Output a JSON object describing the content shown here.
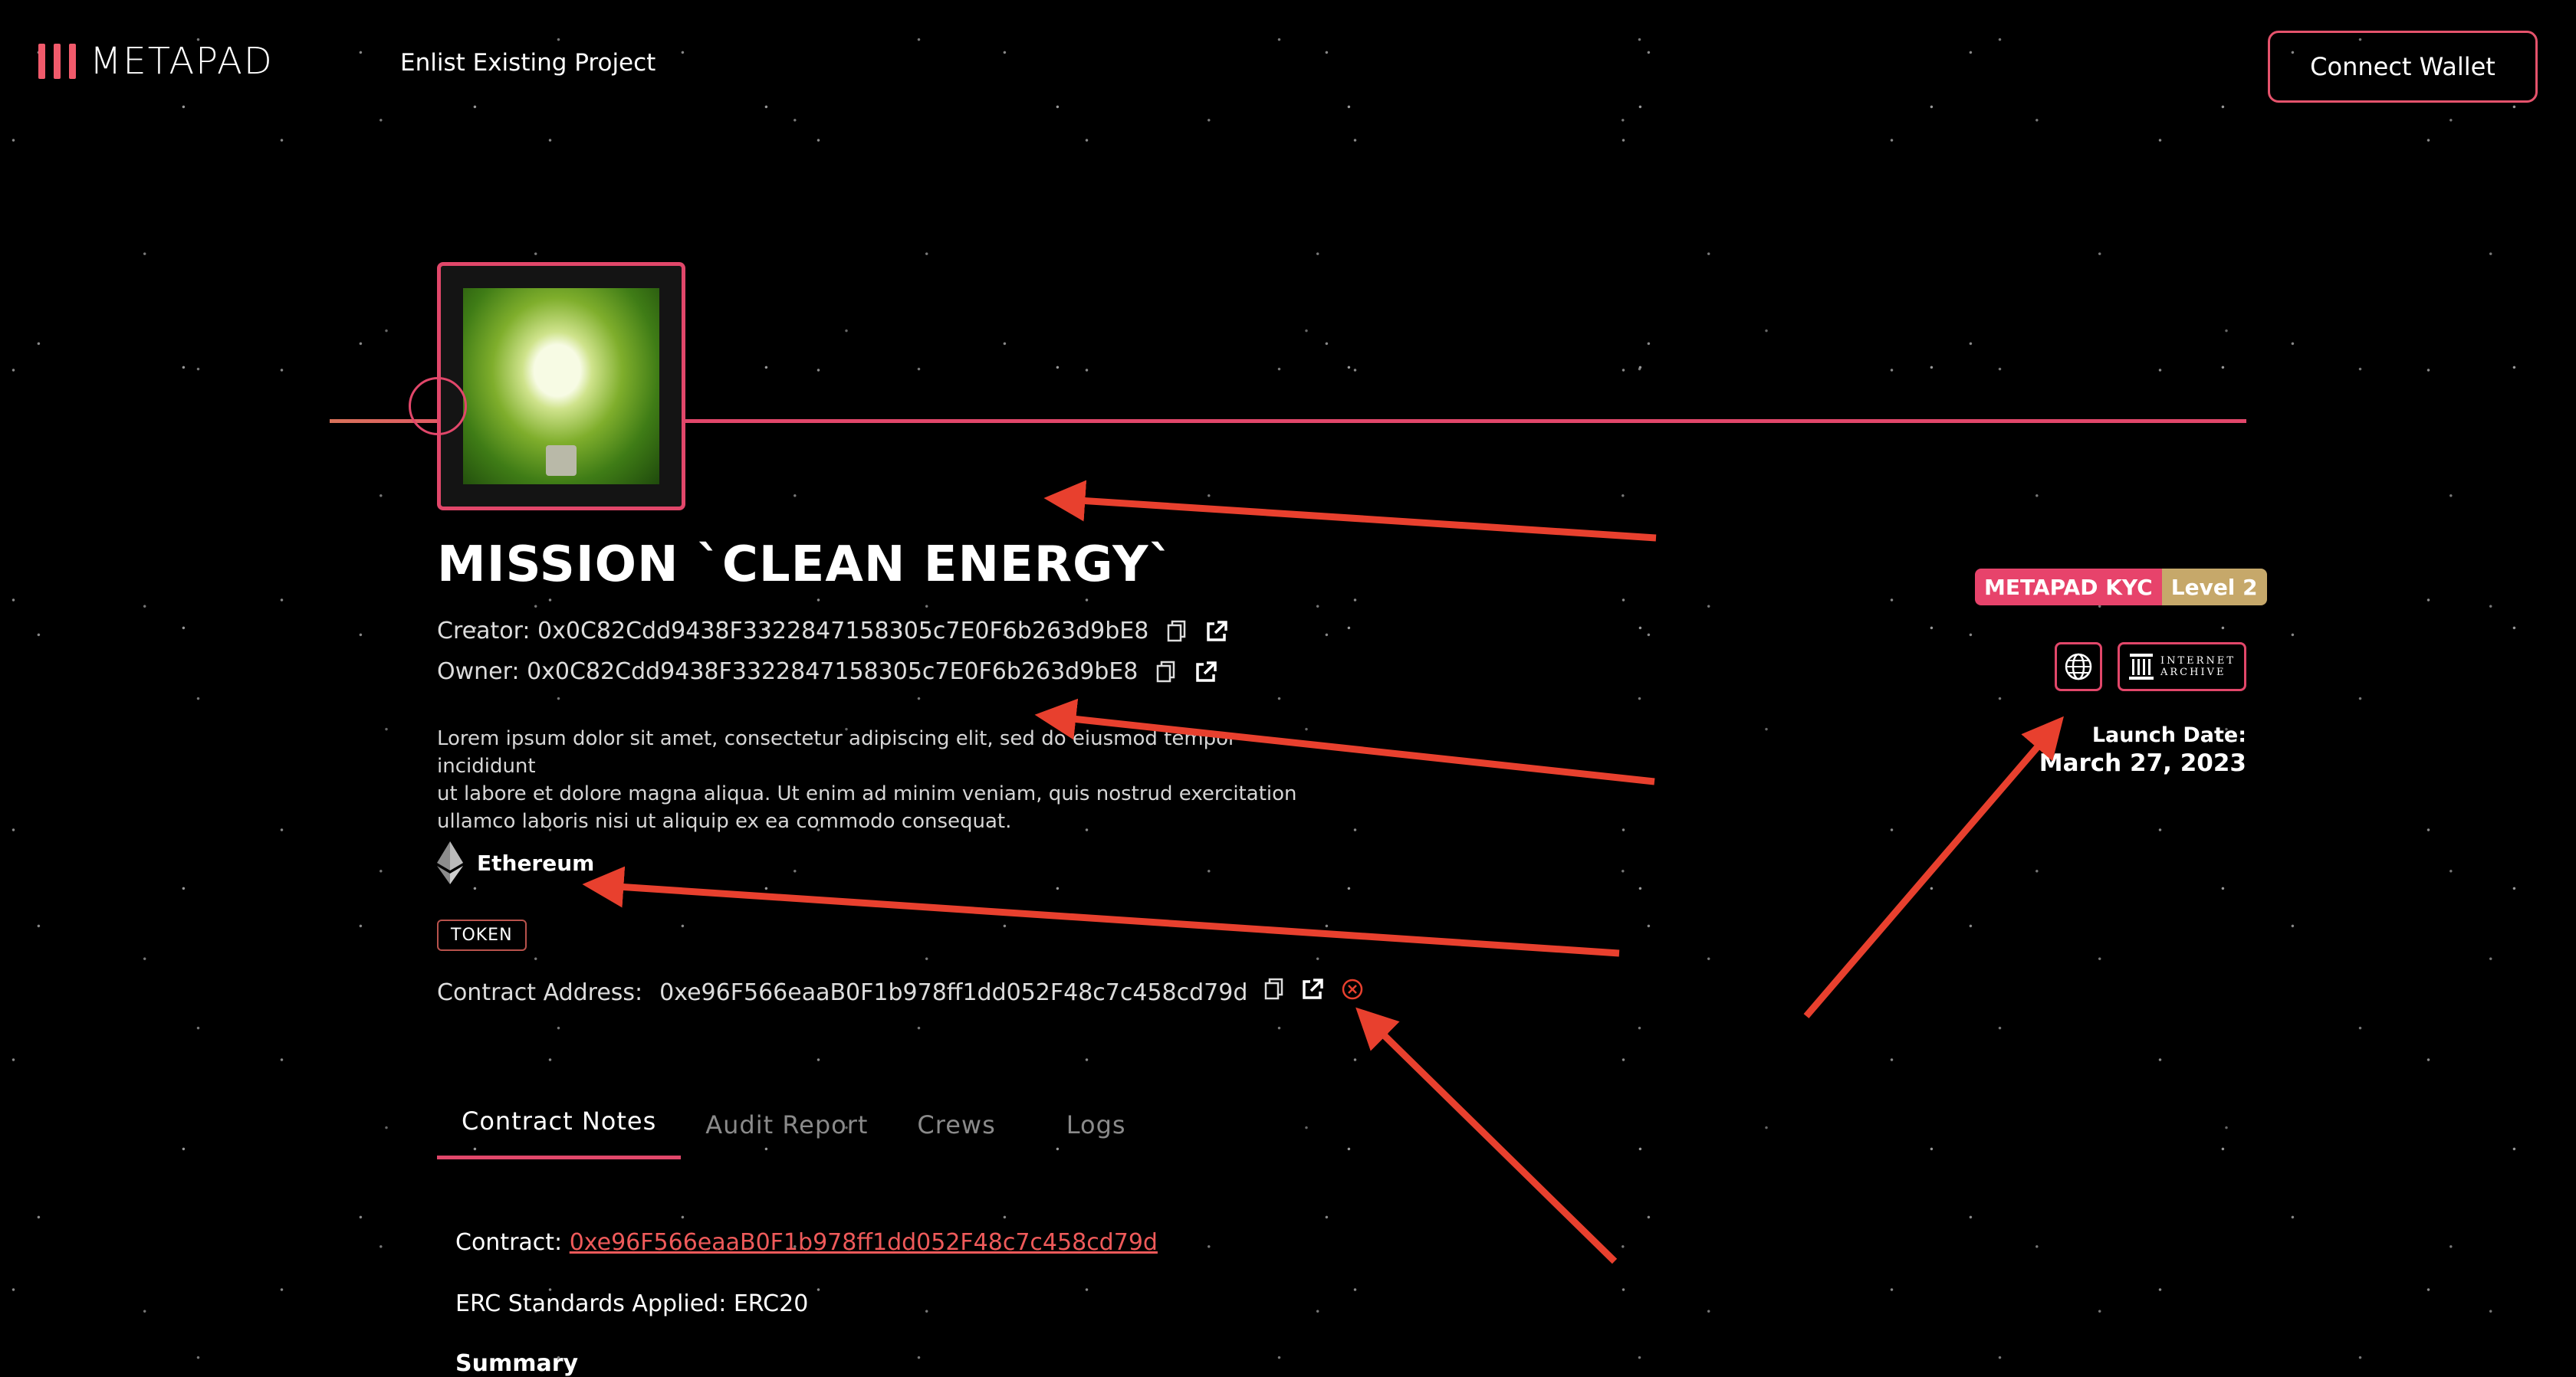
{
  "header": {
    "logo_text": "METAPAD",
    "nav_link": "Enlist Existing Project",
    "connect_button": "Connect Wallet"
  },
  "project": {
    "title": "MISSION `CLEAN ENERGY`",
    "creator_label": "Creator:",
    "creator_address": "0x0C82Cdd9438F3322847158305c7E0F6b263d9bE8",
    "owner_label": "Owner:",
    "owner_address": "0x0C82Cdd9438F3322847158305c7E0F6b263d9bE8",
    "description_lines": [
      "Lorem ipsum dolor sit amet, consectetur adipiscing elit, sed do eiusmod tempor incididunt",
      "ut labore et dolore magna aliqua. Ut enim ad minim veniam, quis nostrud exercitation",
      "ullamco laboris nisi ut aliquip ex ea commodo consequat."
    ],
    "chain": "Ethereum",
    "type_badge": "TOKEN",
    "contract_label": "Contract Address:",
    "contract_address": "0xe96F566eaaB0F1b978ff1dd052F48c7c458cd79d"
  },
  "side": {
    "kyc_label": "METAPAD KYC",
    "kyc_level": "Level 2",
    "internet_archive_line1": "INTERNET",
    "internet_archive_line2": "ARCHIVE",
    "launch_label": "Launch Date:",
    "launch_date": "March 27, 2023"
  },
  "tabs": [
    {
      "label": "Contract Notes",
      "active": true
    },
    {
      "label": "Audit Report",
      "active": false
    },
    {
      "label": "Crews",
      "active": false
    },
    {
      "label": "Logs",
      "active": false
    }
  ],
  "notes": {
    "contract_label": "Contract:",
    "contract_link": "0xe96F566eaaB0F1b978ff1dd052F48c7c458cd79d",
    "erc_line": "ERC Standards Applied: ERC20",
    "summary_heading": "Summary"
  },
  "colors": {
    "accent": "#e1476a",
    "kyc_level_bg": "#c6a86a",
    "annotation_arrow": "#e8402e"
  },
  "icons": [
    "copy-icon",
    "external-link-icon",
    "globe-icon",
    "internet-archive-icon",
    "ethereum-icon",
    "close-circle-icon"
  ]
}
